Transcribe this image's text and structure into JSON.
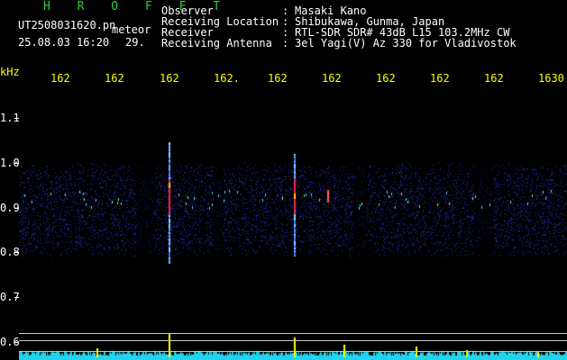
{
  "header": {
    "title": "H R O F F T",
    "filename": "UT2508031620.pn",
    "mode": "meteor",
    "date": "25.08.03 16:20",
    "frame": "29."
  },
  "info": {
    "labels": [
      "Observer",
      "Receiving Location",
      "Receiver",
      "Receiving Antenna"
    ],
    "sep": ":",
    "values": [
      "Masaki Kano",
      "Shibukawa, Gunma, Japan",
      "RTL-SDR SDR# 43dB L15 103.2MHz CW",
      "3el Yagi(V) Az 330 for Vladivostok"
    ]
  },
  "time_axis": {
    "labels": [
      "162",
      "162",
      "162",
      "162.",
      "162",
      "162",
      "162",
      "162",
      "162",
      "1630"
    ]
  },
  "freq_axis": {
    "unit": "kHz",
    "labels": [
      "1.1",
      "1.0",
      "0.9",
      "0.8",
      "0.7",
      "0.6"
    ]
  },
  "colors": {
    "background": "#000000",
    "text": "#ffffff",
    "title": "#2bd13a",
    "ticks": "#ffff00",
    "noise": "#1a1f8f",
    "echo": "#ff2050",
    "power": "#22d3ee",
    "power_peak": "#ffff00"
  }
}
